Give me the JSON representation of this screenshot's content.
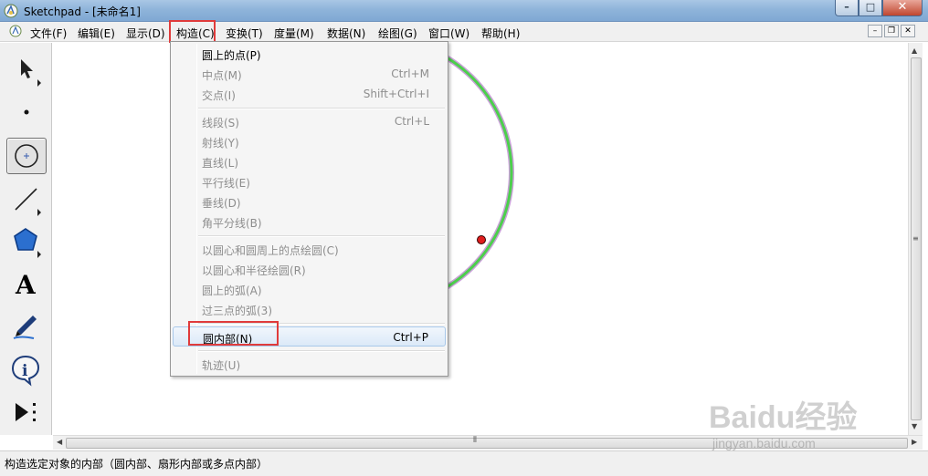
{
  "window": {
    "title": "Sketchpad  - [未命名1]",
    "controls": {
      "minimize": "–",
      "maximize": "□",
      "close": "✕"
    }
  },
  "menubar": {
    "items": [
      {
        "label": "文件(F)"
      },
      {
        "label": "编辑(E)"
      },
      {
        "label": "显示(D)"
      },
      {
        "label": "构造(C)"
      },
      {
        "label": "变换(T)"
      },
      {
        "label": "度量(M)"
      },
      {
        "label": "数据(N)"
      },
      {
        "label": "绘图(G)"
      },
      {
        "label": "窗口(W)"
      },
      {
        "label": "帮助(H)"
      }
    ],
    "mdi_controls": {
      "minimize": "–",
      "restore": "❐",
      "close": "✕"
    },
    "active_menu": "构造(C)"
  },
  "toolbox": {
    "tools": [
      {
        "icon": "arrow-select-icon"
      },
      {
        "icon": "point-tool-icon"
      },
      {
        "icon": "compass-tool-icon",
        "selected": true
      },
      {
        "icon": "straightedge-tool-icon"
      },
      {
        "icon": "polygon-tool-icon"
      },
      {
        "icon": "text-tool-icon",
        "glyph": "A"
      },
      {
        "icon": "marker-tool-icon"
      },
      {
        "icon": "information-tool-icon"
      },
      {
        "icon": "custom-tool-icon"
      }
    ]
  },
  "dropdown": {
    "items": [
      {
        "label": "圆上的点(P)",
        "shortcut": "",
        "enabled": true
      },
      {
        "label": "中点(M)",
        "shortcut": "Ctrl+M",
        "enabled": false
      },
      {
        "label": "交点(I)",
        "shortcut": "Shift+Ctrl+I",
        "enabled": false
      },
      {
        "label": "线段(S)",
        "shortcut": "Ctrl+L",
        "enabled": false
      },
      {
        "label": "射线(Y)",
        "shortcut": "",
        "enabled": false
      },
      {
        "label": "直线(L)",
        "shortcut": "",
        "enabled": false
      },
      {
        "label": "平行线(E)",
        "shortcut": "",
        "enabled": false
      },
      {
        "label": "垂线(D)",
        "shortcut": "",
        "enabled": false
      },
      {
        "label": "角平分线(B)",
        "shortcut": "",
        "enabled": false
      },
      {
        "label": "以圆心和圆周上的点绘圆(C)",
        "shortcut": "",
        "enabled": false
      },
      {
        "label": "以圆心和半径绘圆(R)",
        "shortcut": "",
        "enabled": false
      },
      {
        "label": "圆上的弧(A)",
        "shortcut": "",
        "enabled": false
      },
      {
        "label": "过三点的弧(3)",
        "shortcut": "",
        "enabled": false
      },
      {
        "label": "圆内部(N)",
        "shortcut": "Ctrl+P",
        "enabled": true,
        "hover": true
      },
      {
        "label": "轨迹(U)",
        "shortcut": "",
        "enabled": false
      }
    ]
  },
  "canvas": {
    "circle_color": "#4ccf4c",
    "circle_outline_color": "#c9a0d8",
    "point_color": "#e01e1e"
  },
  "statusbar": {
    "text": "构造选定对象的内部（圆内部、扇形内部或多点内部）"
  },
  "watermark": {
    "brand": "Baidu经验",
    "site": "jingyan.baidu.com"
  },
  "colors": {
    "highlight_box": "#e03b3b",
    "menu_hover_bg": "#dbe9f8"
  }
}
